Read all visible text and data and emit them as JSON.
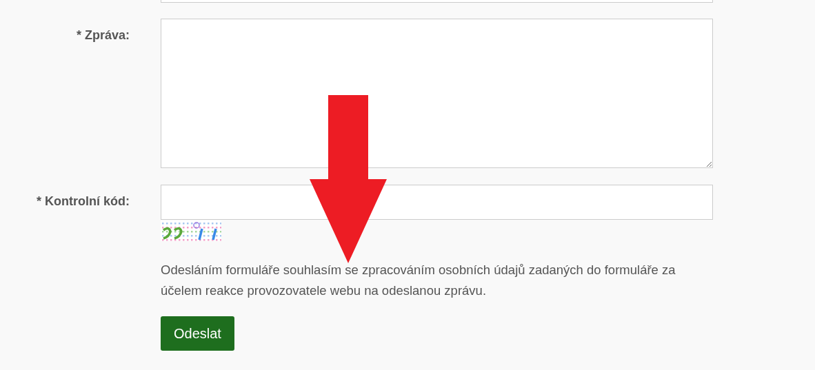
{
  "form": {
    "fields": [
      {
        "kind": "input_cut"
      },
      {
        "kind": "textarea",
        "label": "* Zpráva:"
      },
      {
        "kind": "input",
        "label": "* Kontrolní kód:"
      }
    ],
    "consent": "Odesláním formuláře souhlasím se zpracováním osobních údajů zadaných do formuláře za účelem reakce provozovatele webu na odeslanou zprávu.",
    "submit_button": "Odeslat"
  },
  "annotation": {
    "kind": "arrow"
  }
}
